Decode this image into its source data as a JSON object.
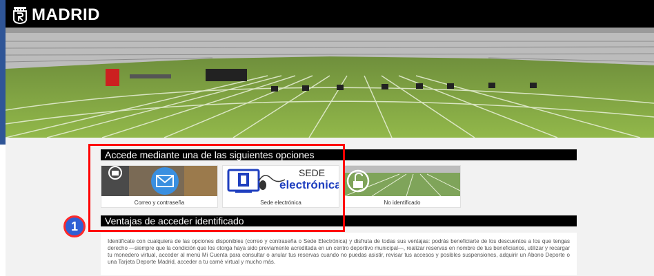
{
  "header": {
    "logo_text": "MADRID",
    "logo_icon": "madrid-crest-icon"
  },
  "section1": {
    "title": "Accede mediante una de las siguientes opciones"
  },
  "options": [
    {
      "label": "Correo y contraseña",
      "icon": "email-icon"
    },
    {
      "label": "Sede electrónica",
      "icon": "sede-electronica-logo",
      "logo_line1": "SEDE",
      "logo_line2": "electrónica"
    },
    {
      "label": "No identificado",
      "icon": "unlock-icon"
    }
  ],
  "section2": {
    "title": "Ventajas de acceder identificado"
  },
  "description": "Identifícate con cualquiera de las opciones disponibles (correo y contraseña o Sede Electrónica) y disfruta de todas sus ventajas: podrás beneficiarte de los descuentos a los que tengas derecho —siempre que la condición que los otorga haya sido previamente acreditada en un centro deportivo municipal—, realizar reservas en nombre de tus beneficiarios, utilizar y recargar tu monedero virtual, acceder al menú Mi Cuenta para consultar o anular tus reservas cuando no puedas asistir, revisar tus accesos y posibles suspensiones, adquirir un Abono Deporte o una Tarjeta Deporte Madrid, acceder a tu carné virtual y mucho más.",
  "annotation": {
    "badge_number": "1"
  },
  "colors": {
    "accent_blue": "#2f5597",
    "highlight_red": "#ff0000",
    "sede_blue": "#1f3fbf"
  }
}
